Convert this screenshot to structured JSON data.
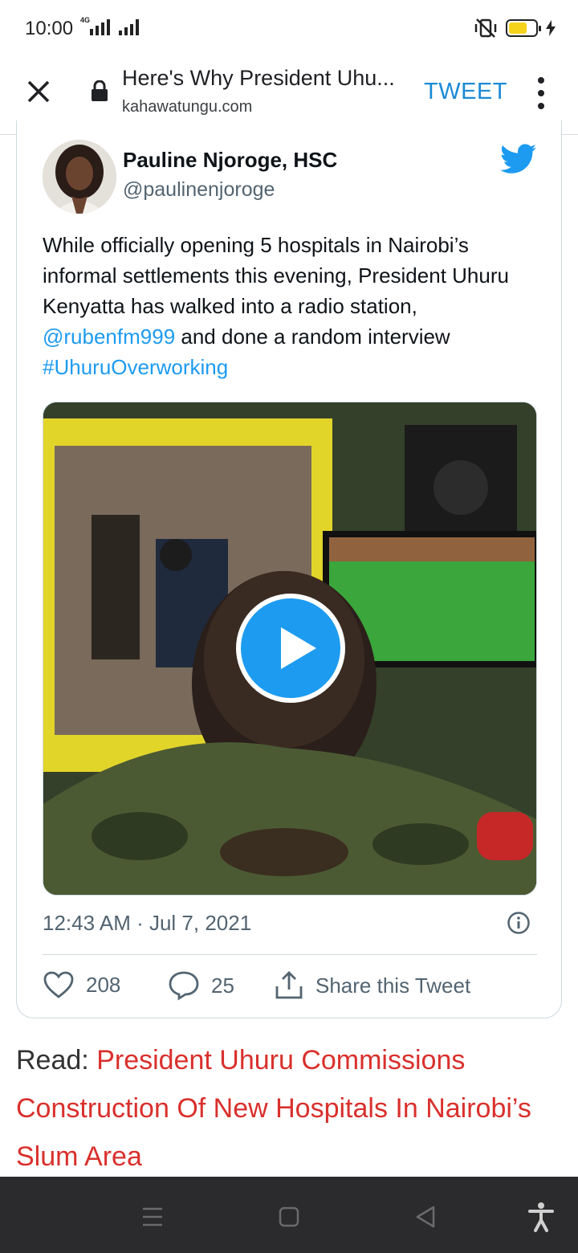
{
  "status_bar": {
    "time": "10:00",
    "network": "4G"
  },
  "browser": {
    "page_title": "Here's Why President Uhu...",
    "domain": "kahawatungu.com",
    "tweet_action": "TWEET",
    "icons": [
      "close-icon",
      "lock-icon",
      "more-vert-icon"
    ]
  },
  "tweet": {
    "author_name": "Pauline Njoroge, HSC",
    "author_handle": "@paulinenjoroge",
    "text_part1": "While officially opening 5 hospitals in Nairobi’s informal settlements this evening, President Uhuru Kenyatta has walked into a radio station, ",
    "mention": "@rubenfm999",
    "text_part2": " and done a random interview ",
    "hashtag": "#UhuruOverworking",
    "timestamp": "12:43 AM · Jul 7, 2021",
    "likes": "208",
    "replies": "25",
    "share_label": "Share this Tweet"
  },
  "read_more": {
    "prefix": "Read: ",
    "link_text": "President Uhuru Commissions Construction Of New Hospitals In Nairobi’s Slum Area"
  },
  "colors": {
    "twitter_blue": "#1d9bf0",
    "link_red": "#d9302c",
    "tweet_action_blue": "#1a8ad6",
    "navbar_bg": "#2b2b2d"
  }
}
